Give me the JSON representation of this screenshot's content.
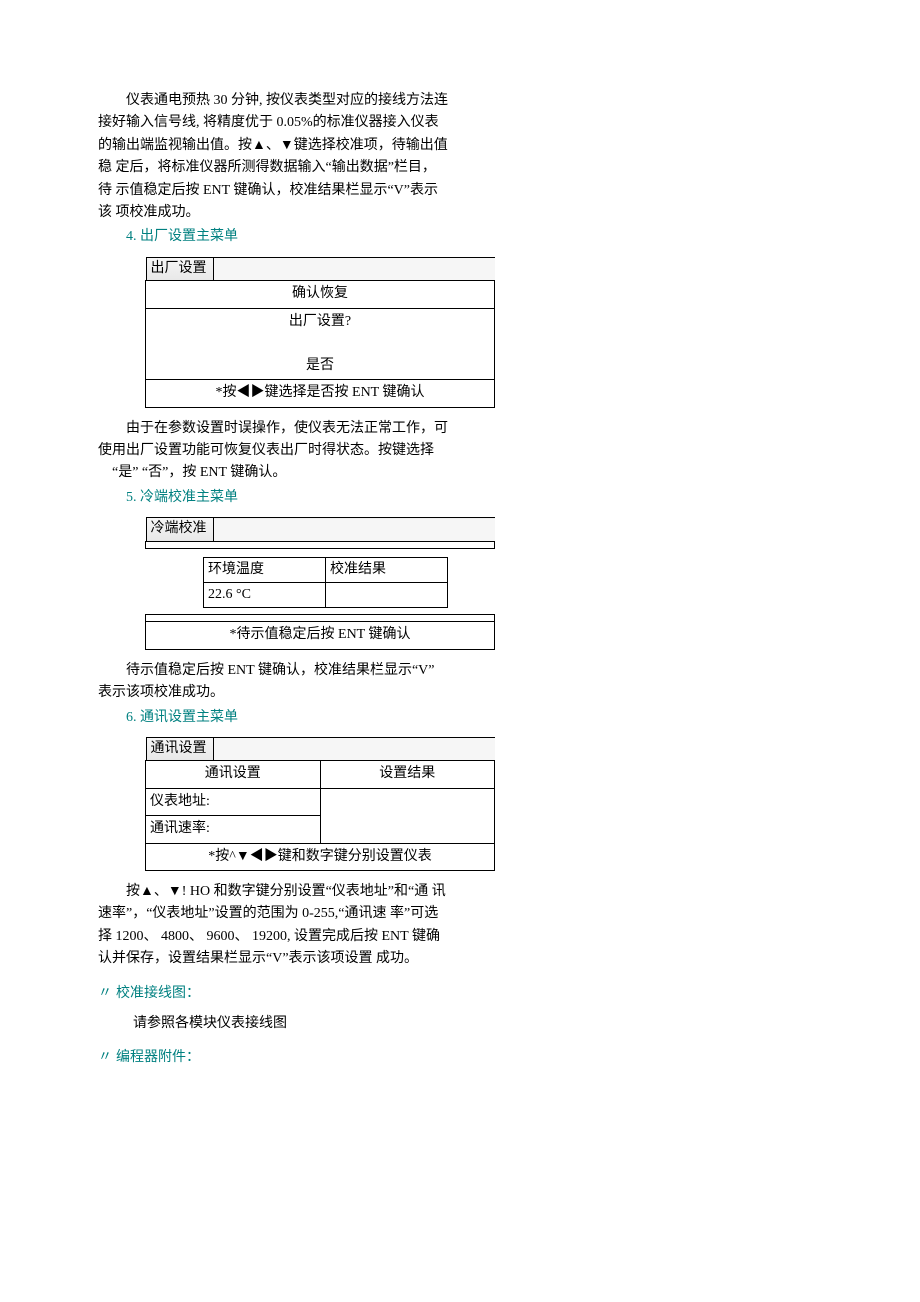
{
  "intro": "仪表通电预热 30 分钟, 按仪表类型对应的接线方法连  接好输入信号线, 将精度优于 0.05%的标准仪器接入仪表  的输出端监视输出值。按▲、▼键选择校准项，待输出值稳  定后，将标准仪器所测得数据输入“输出数据”栏目，待  示值稳定后按 ENT 键确认，校准结果栏显示“V”表示该  项校准成功。",
  "h4_num": "4.",
  "h4_title": "出厂设置主菜单",
  "box4": {
    "title": "出厂设置",
    "line1": "确认恢复",
    "line2": "出厂设置?",
    "line3": "是否",
    "footer": "*按◀▶键选择是否按 ENT 键确认"
  },
  "p4a": "由于在参数设置时误操作，使仪表无法正常工作，可使用出厂设置功能可恢复仪表出厂时得状态。按键选择",
  "p4b": "“是”  “否”，按 ENT 键确认。",
  "h5_num": "5.",
  "h5_title": "冷端校准主菜单",
  "box5": {
    "title": "冷端校准",
    "col_env": "环境温度",
    "col_res": "校准结果",
    "val": "22.6 °C",
    "footer": "*待示值稳定后按 ENT 键确认"
  },
  "p5": "待示值稳定后按 ENT 键确认，校准结果栏显示“V” 表示该项校准成功。",
  "h6_num": "6.",
  "h6_title": "通讯设置主菜单",
  "box6": {
    "title": "通讯设置",
    "col_set": "通讯设置",
    "col_res": "设置结果",
    "row_addr": "仪表地址:",
    "row_rate": "通讯速率:",
    "footer": "*按^▼◀▶键和数字键分别设置仪表"
  },
  "p6": "按▲、▼!  HO 和数字键分别设置“仪表地址”和“通  讯速率”，“仪表地址”设置的范围为 0-255,“通讯速  率”可选择  1200、 4800、 9600、 19200, 设置完成后按  ENT 键确认并保存，设置结果栏显示“V”表示该项设置  成功。",
  "sec_wiring": "校准接线图",
  "p_wiring": "请参照各模块仪表接线图",
  "sec_accessory": "编程器附件"
}
